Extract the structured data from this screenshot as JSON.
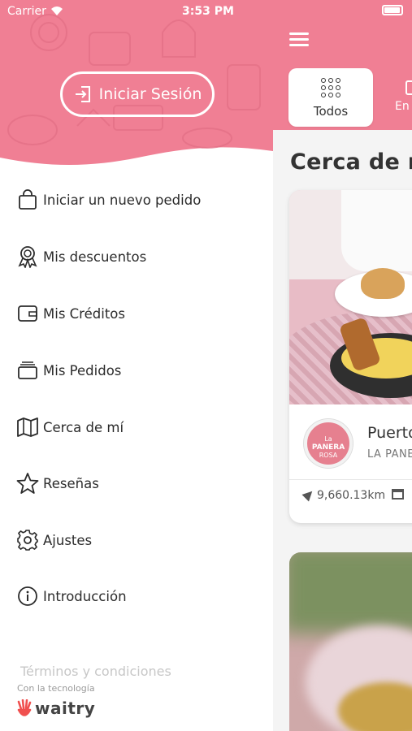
{
  "status_bar": {
    "carrier": "Carrier",
    "time": "3:53 PM"
  },
  "drawer": {
    "login_button": "Iniciar Sesión",
    "menu": [
      {
        "label": "Iniciar un nuevo pedido",
        "icon": "shopping-bag-icon"
      },
      {
        "label": "Mis descuentos",
        "icon": "award-ribbon-icon"
      },
      {
        "label": "Mis Créditos",
        "icon": "wallet-icon"
      },
      {
        "label": "Mis Pedidos",
        "icon": "orders-stack-icon"
      },
      {
        "label": "Cerca de mí",
        "icon": "map-icon"
      },
      {
        "label": "Reseñas",
        "icon": "star-icon"
      },
      {
        "label": "Ajustes",
        "icon": "gear-icon"
      },
      {
        "label": "Introducción",
        "icon": "info-icon"
      }
    ],
    "terms": "Términos y condiciones",
    "powered_by": "Con la tecnología",
    "brand": "waitry"
  },
  "main": {
    "tabs": [
      {
        "label": "Todos",
        "icon": "grid-icon"
      },
      {
        "label": "En",
        "icon": "bag-icon"
      }
    ],
    "section_title": "Cerca de mí",
    "card": {
      "logo_text": {
        "top": "La",
        "middle": "PANERA",
        "bottom": "ROSA"
      },
      "name": "Puerto",
      "subtitle": "LA PANERA ROSA",
      "distance": "9,660.13km"
    }
  },
  "colors": {
    "brand_pink": "#f07f94",
    "drawer_bg": "#ffffff",
    "text": "#2b2b2b",
    "muted": "#c7c7c7"
  }
}
